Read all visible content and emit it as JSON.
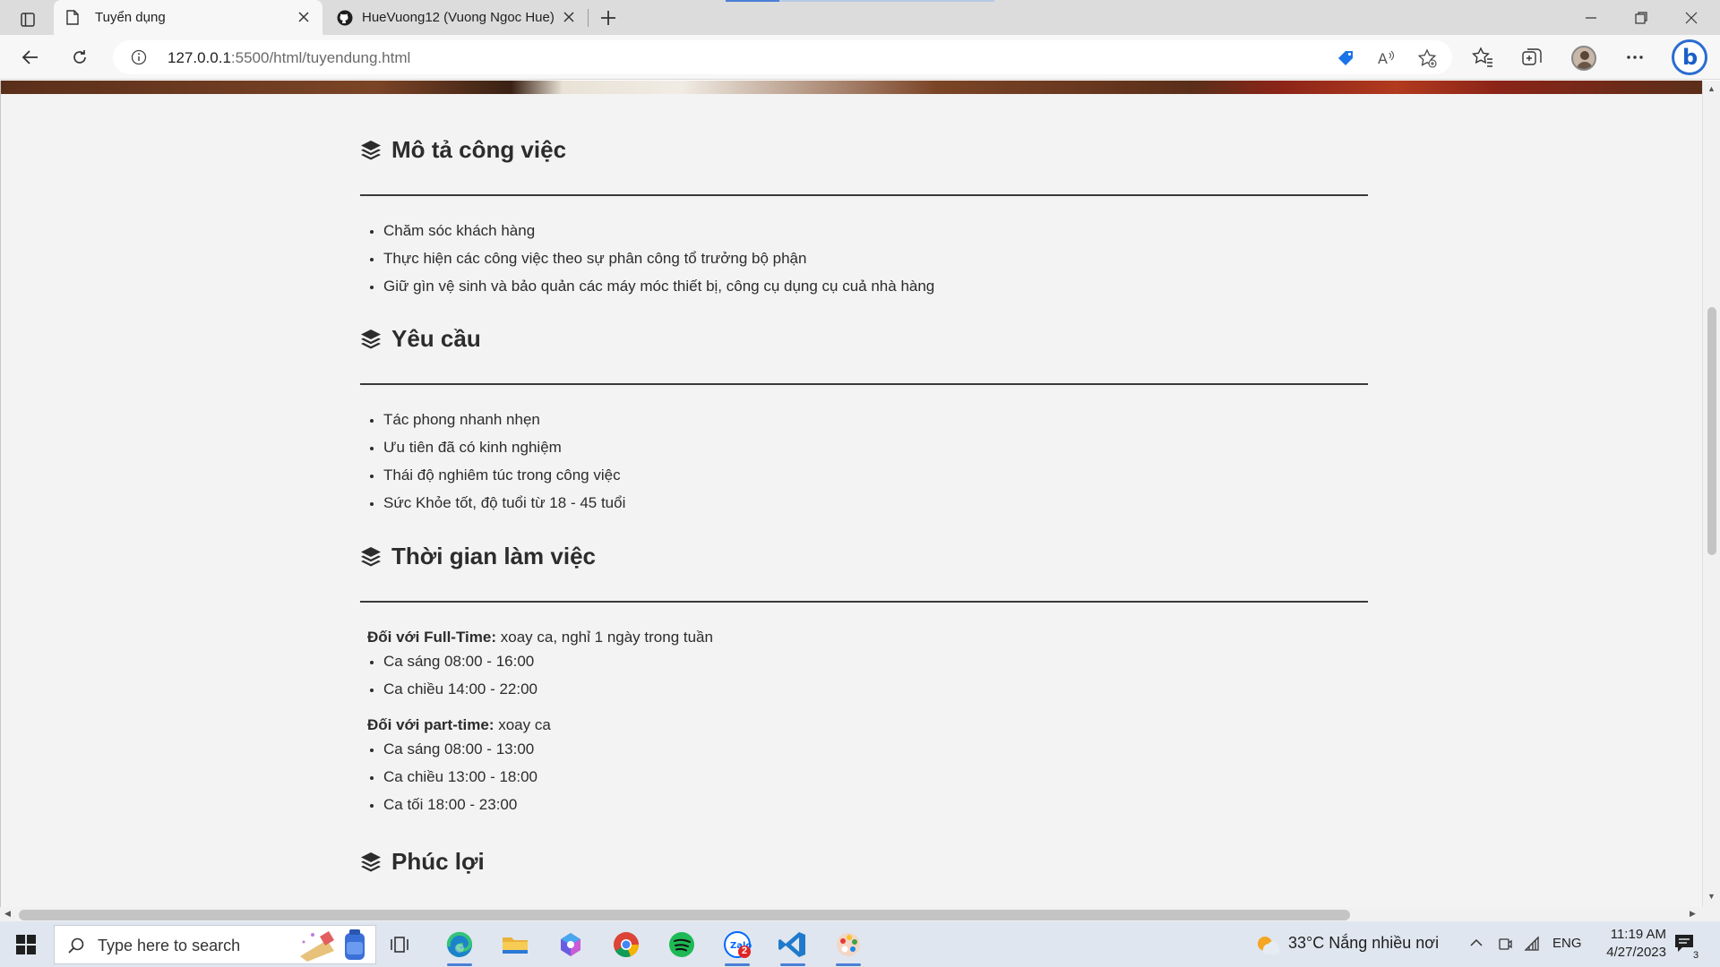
{
  "browser": {
    "tabs": [
      {
        "label": "Tuyển dụng",
        "favicon": "page-icon",
        "active": true
      },
      {
        "label": "HueVuong12 (Vuong Ngoc Hue)",
        "favicon": "github-icon",
        "active": false
      }
    ],
    "address": {
      "host": "127.0.0.1",
      "rest": ":5500/html/tuyendung.html"
    }
  },
  "page": {
    "sections": [
      {
        "title": "Mô tả công việc",
        "items": [
          "Chăm sóc khách hàng",
          "Thực hiện các công việc theo sự phân công tổ trưởng bộ phận",
          "Giữ gìn vệ sinh và bảo quản các máy móc thiết bị, công cụ dụng cụ cuả nhà hàng"
        ]
      },
      {
        "title": "Yêu cầu",
        "items": [
          "Tác phong nhanh nhẹn",
          "Ưu tiên đã có kinh nghiệm",
          "Thái độ nghiêm túc trong công việc",
          "Sức Khỏe tốt, độ tuổi từ 18 - 45 tuổi"
        ]
      },
      {
        "title": "Thời gian làm việc",
        "groups": [
          {
            "label": "Đối với Full-Time:",
            "note": " xoay ca, nghỉ 1 ngày trong tuần",
            "items": [
              "Ca sáng 08:00 - 16:00",
              "Ca chiều 14:00 - 22:00"
            ]
          },
          {
            "label": "Đối với part-time:",
            "note": " xoay ca",
            "items": [
              "Ca sáng 08:00 - 13:00",
              "Ca chiều 13:00 - 18:00",
              "Ca tối 18:00 - 23:00"
            ]
          }
        ]
      },
      {
        "title": "Phúc lợi"
      }
    ]
  },
  "taskbar": {
    "search_placeholder": "Type here to search",
    "weather": "33°C  Nắng nhiều nơi",
    "language": "ENG",
    "time": "11:19 AM",
    "date": "4/27/2023",
    "notification_count": "3",
    "zalo_badge": "2",
    "apps": [
      "task-view-icon",
      "edge-icon",
      "file-explorer-icon",
      "copilot-icon",
      "chrome-icon",
      "spotify-icon",
      "zalo-icon",
      "vscode-icon",
      "paint-icon"
    ]
  },
  "colors": {
    "accent": "#4a7fd6",
    "heading": "#2c2c2c",
    "page_bg": "#f3f3f3"
  }
}
